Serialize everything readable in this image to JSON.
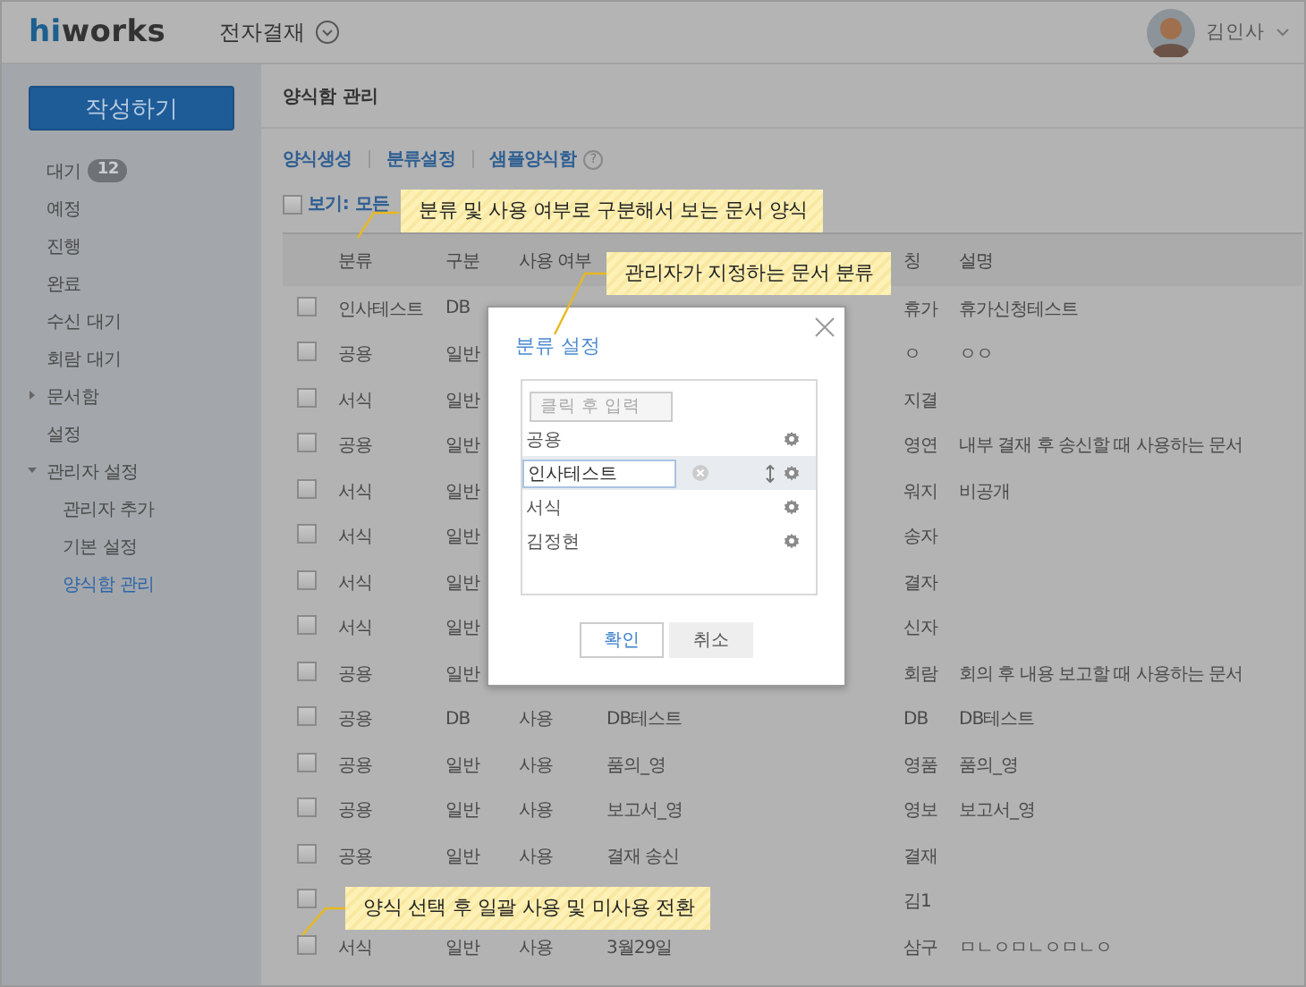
{
  "header": {
    "logo": {
      "accent": "hi",
      "rest": "works"
    },
    "app_title": "전자결재",
    "user_name": "김인사"
  },
  "sidebar": {
    "compose_button": "작성하기",
    "items": [
      {
        "label": "대기",
        "badge": "12",
        "selected": false
      },
      {
        "label": "예정",
        "selected": false
      },
      {
        "label": "진행",
        "selected": false
      },
      {
        "label": "완료",
        "selected": false
      },
      {
        "label": "수신 대기",
        "selected": false
      },
      {
        "label": "회람 대기",
        "selected": false
      },
      {
        "label": "문서함",
        "expanded": false,
        "selected": false
      },
      {
        "label": "설정",
        "selected": false
      },
      {
        "label": "관리자 설정",
        "expanded": true,
        "selected": false,
        "children": [
          {
            "label": "관리자 추가",
            "selected": false
          },
          {
            "label": "기본 설정",
            "selected": false
          },
          {
            "label": "양식함 관리",
            "selected": true
          }
        ]
      }
    ]
  },
  "main": {
    "title": "양식함 관리",
    "links": [
      {
        "label": "양식생성"
      },
      {
        "label": "분류설정"
      },
      {
        "label": "샘플양식함",
        "help": "?"
      }
    ],
    "filter": {
      "label": "보기: 모든",
      "checked": false
    },
    "table": {
      "columns": {
        "category": "분류",
        "type": "구분",
        "usage": "사용 여부",
        "abbr": "칭",
        "description": "설명"
      },
      "rows": [
        {
          "checked": false,
          "category": "인사테스트",
          "type": "DB",
          "abbr": "휴가",
          "description": "휴가신청테스트"
        },
        {
          "checked": false,
          "category": "공용",
          "type": "일반",
          "abbr": "ㅇ",
          "description": "ㅇㅇ"
        },
        {
          "checked": false,
          "category": "서식",
          "type": "일반",
          "abbr": "지결"
        },
        {
          "checked": false,
          "category": "공용",
          "type": "일반",
          "abbr": "영연",
          "description": "내부 결재 후 송신할 때 사용하는 문서"
        },
        {
          "checked": false,
          "category": "서식",
          "type": "일반",
          "abbr": "워지",
          "description": "비공개"
        },
        {
          "checked": false,
          "category": "서식",
          "type": "일반",
          "abbr": "송자"
        },
        {
          "checked": false,
          "category": "서식",
          "type": "일반",
          "abbr": "결자"
        },
        {
          "checked": false,
          "category": "서식",
          "type": "일반",
          "abbr": "신자"
        },
        {
          "checked": false,
          "category": "공용",
          "type": "일반",
          "abbr": "회람",
          "description": "회의 후 내용 보고할 때 사용하는 문서"
        },
        {
          "checked": false,
          "category": "공용",
          "type": "DB",
          "usage": "사용",
          "name": "DB테스트",
          "abbr": "DB",
          "description": "DB테스트"
        },
        {
          "checked": false,
          "category": "공용",
          "type": "일반",
          "usage": "사용",
          "name": "품의_영",
          "abbr": "영품",
          "description": "품의_영"
        },
        {
          "checked": false,
          "category": "공용",
          "type": "일반",
          "usage": "사용",
          "name": "보고서_영",
          "abbr": "영보",
          "description": "보고서_영"
        },
        {
          "checked": false,
          "category": "공용",
          "type": "일반",
          "usage": "사용",
          "name": "결재 송신",
          "abbr": "결재"
        },
        {
          "checked": false,
          "abbr": "김1"
        },
        {
          "checked": false,
          "category": "서식",
          "type": "일반",
          "usage": "사용",
          "name": "3월29일",
          "abbr": "삼구",
          "description": "ㅁㄴㅇㅁㄴㅇㅁㄴㅇ"
        }
      ]
    }
  },
  "modal": {
    "title": "분류 설정",
    "input_placeholder": "클릭 후 입력",
    "categories": [
      {
        "label": "공용",
        "editing": false
      },
      {
        "label": "인사테스트",
        "editing": true
      },
      {
        "label": "서식",
        "editing": false
      },
      {
        "label": "김정현",
        "editing": false
      }
    ],
    "buttons": [
      {
        "label": "확인",
        "kind": "primary"
      },
      {
        "label": "취소",
        "kind": "secondary"
      }
    ]
  },
  "callouts": [
    {
      "text": "분류 및 사용 여부로 구분해서 보는 문서 양식"
    },
    {
      "text": "관리자가 지정하는 문서 분류"
    },
    {
      "text": "양식 선택 후 일괄 사용 및 미사용 전환"
    }
  ]
}
